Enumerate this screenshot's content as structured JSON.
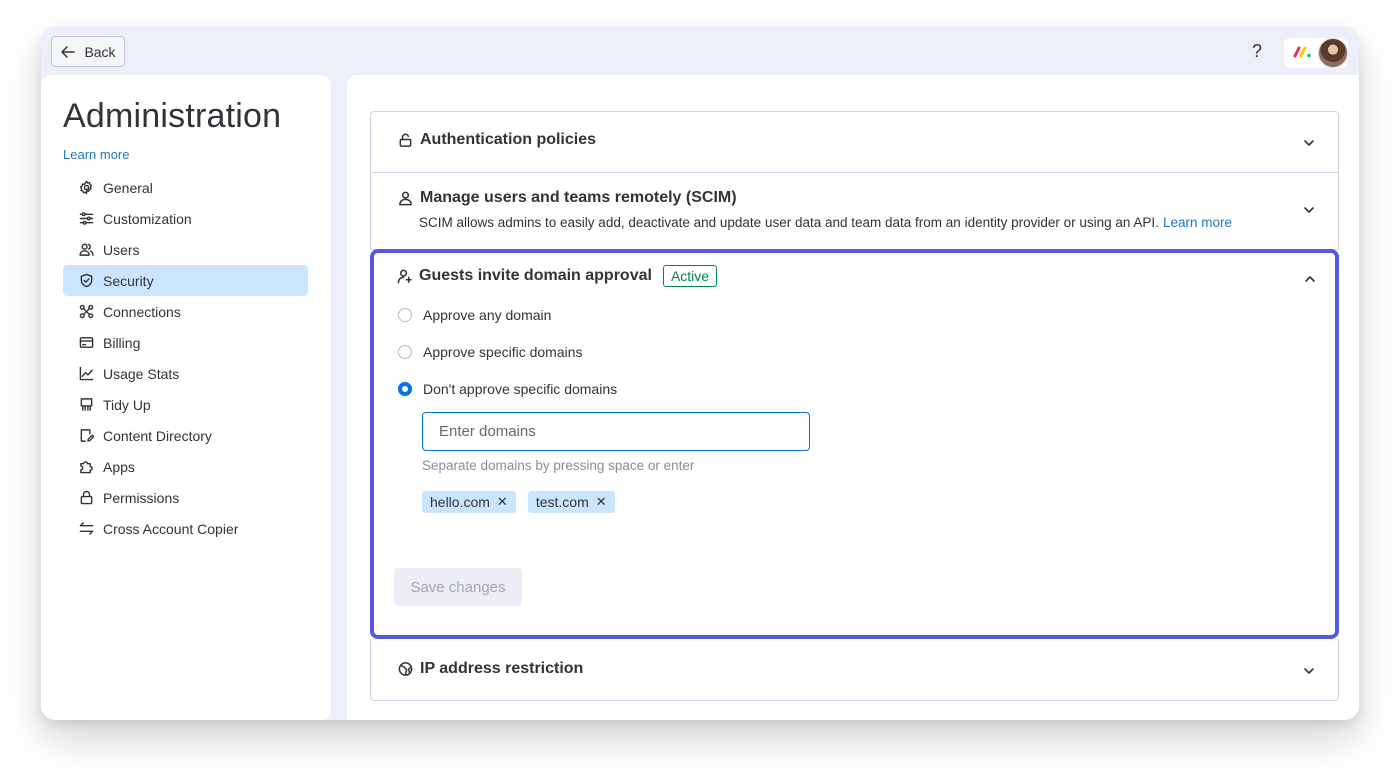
{
  "topbar": {
    "back_label": "Back",
    "help_glyph": "?"
  },
  "sidebar": {
    "title": "Administration",
    "learn_more": "Learn more",
    "items": [
      {
        "label": "General",
        "icon": "gear-icon"
      },
      {
        "label": "Customization",
        "icon": "sliders-icon"
      },
      {
        "label": "Users",
        "icon": "users-icon"
      },
      {
        "label": "Security",
        "icon": "shield-icon",
        "selected": true
      },
      {
        "label": "Connections",
        "icon": "connections-icon"
      },
      {
        "label": "Billing",
        "icon": "credit-card-icon"
      },
      {
        "label": "Usage Stats",
        "icon": "chart-icon"
      },
      {
        "label": "Tidy Up",
        "icon": "broom-icon"
      },
      {
        "label": "Content Directory",
        "icon": "document-edit-icon"
      },
      {
        "label": "Apps",
        "icon": "puzzle-icon"
      },
      {
        "label": "Permissions",
        "icon": "lock-icon"
      },
      {
        "label": "Cross Account Copier",
        "icon": "arrows-swap-icon"
      }
    ]
  },
  "sections": {
    "auth": {
      "title": "Authentication policies",
      "icon": "unlock-icon"
    },
    "scim": {
      "title": "Manage users and teams remotely (SCIM)",
      "icon": "user-icon",
      "description": "SCIM allows admins to easily add, deactivate and update user data and team data from an identity provider or using an API.",
      "learn_more": "Learn more"
    },
    "guests": {
      "title": "Guests invite domain approval",
      "icon": "user-add-icon",
      "badge": "Active",
      "options": [
        {
          "label": "Approve any domain",
          "checked": false
        },
        {
          "label": "Approve specific domains",
          "checked": false
        },
        {
          "label": "Don't approve specific domains",
          "checked": true
        }
      ],
      "input_placeholder": "Enter domains",
      "hint": "Separate domains by pressing space or enter",
      "domains": [
        "hello.com",
        "test.com"
      ],
      "save_label": "Save changes"
    },
    "ip": {
      "title": "IP address restriction",
      "icon": "globe-icon"
    }
  },
  "colors": {
    "accent": "#0073ea",
    "highlight_border": "#5559df",
    "selected_nav": "#cce5ff",
    "badge_green": "#00854d",
    "link": "#1f76c2"
  }
}
